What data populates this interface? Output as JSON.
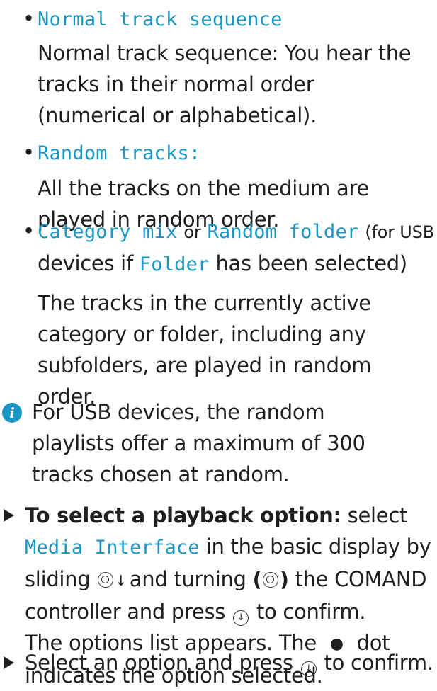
{
  "items": [
    {
      "term": "Normal track sequence",
      "description": "Normal track sequence: You hear the tracks in their normal order (numerical or alphabetical)."
    },
    {
      "term": "Random tracks:",
      "description": "All the tracks on the medium are played in random order."
    },
    {
      "term1": "Category mix",
      "or": "or",
      "term2": "Random folder",
      "paren_text": "(for USB",
      "line2_a": "devices if",
      "term3": "Folder",
      "line2_b": "has been selected)",
      "description": "The tracks in the currently active category or folder, including any subfolders, are played in random order."
    }
  ],
  "note": {
    "icon": "info-icon",
    "text": "For USB devices, the random playlists offer a maximum of 300 tracks chosen at random."
  },
  "steps": [
    {
      "icon": "arrow-right-icon",
      "bold_lead": "To select a playback option:",
      "text_a": "select",
      "term": "Media Interface",
      "text_b": "in the basic display by",
      "text_c": "sliding",
      "text_d": "and turning",
      "text_e": "the COMAND",
      "text_f": "controller and press",
      "text_g": "to confirm.",
      "result_a": "The options list appears. The",
      "result_b": "dot",
      "result_c": "indicates the option selected."
    },
    {
      "icon": "arrow-right-icon",
      "text_a": "Select an option and press",
      "text_b": "to confirm."
    }
  ],
  "bullet_glyph": "•",
  "selected_dot_glyph": "●",
  "accent_color": "#1a97c5"
}
